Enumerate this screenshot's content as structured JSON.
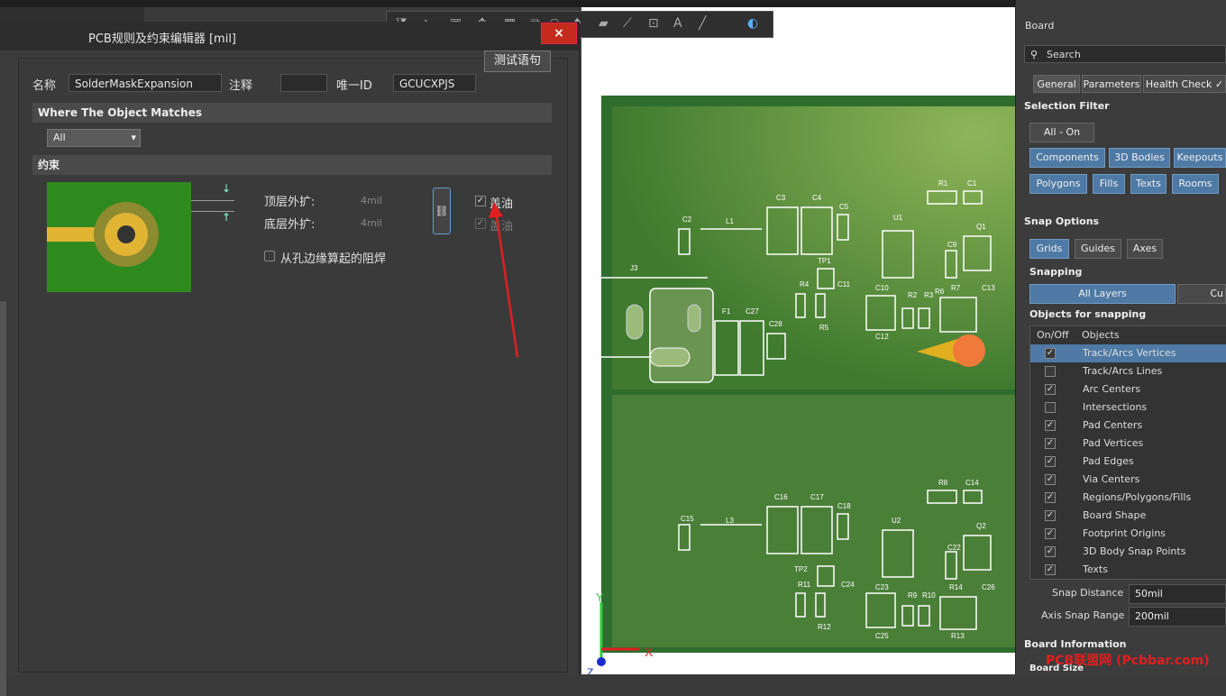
{
  "dialog": {
    "title": "PCB规则及约束编辑器 [mil]",
    "close": "×",
    "name_label": "名称",
    "name_value": "SolderMaskExpansion",
    "comment_label": "注释",
    "comment_value": "",
    "id_label": "唯一ID",
    "id_value": "GCUCXPJS",
    "test_button": "测试语句",
    "where_section": "Where The Object Matches",
    "where_value": "All",
    "constraint_section": "约束",
    "top_expand_label": "顶层外扩:",
    "top_expand_value": "4mil",
    "bottom_expand_label": "底层外扩:",
    "bottom_expand_value": "4mil",
    "cover_oil_1": "盖油",
    "cover_oil_2": "盖油",
    "from_hole_label": "从孔边缘算起的阻焊"
  },
  "pcb": {
    "labels": [
      "C2",
      "L1",
      "C3",
      "C4",
      "C5",
      "U1",
      "R1",
      "C1",
      "Q1",
      "C9",
      "J3",
      "TP1",
      "R4",
      "C11",
      "C10",
      "R2",
      "R3",
      "R6",
      "R7",
      "C13",
      "F1",
      "C27",
      "C28",
      "R5",
      "C12",
      "R8",
      "C14",
      "C15",
      "L3",
      "C16",
      "C17",
      "C18",
      "U2",
      "Q2",
      "C22",
      "TP2",
      "R11",
      "C24",
      "C23",
      "R9",
      "R10",
      "R14",
      "C26",
      "R12",
      "C25",
      "R13"
    ],
    "axis_y": "Y",
    "axis_x": "X",
    "axis_z": "Z"
  },
  "panel": {
    "title": "Board",
    "search_placeholder": "Search",
    "tabs": [
      "General",
      "Parameters",
      "Health Check ✓"
    ],
    "selection_filter": "Selection Filter",
    "all_on": "All - On",
    "filter_row1": [
      "Components",
      "3D Bodies",
      "Keepouts"
    ],
    "filter_row2": [
      "Polygons",
      "Fills",
      "Texts",
      "Rooms"
    ],
    "snap_options": "Snap Options",
    "snap_buttons": [
      "Grids",
      "Guides",
      "Axes"
    ],
    "snapping_label": "Snapping",
    "all_layers": "All Layers",
    "current_layer": "Cu",
    "objects_for_snapping": "Objects for snapping",
    "col_onoff": "On/Off",
    "col_objects": "Objects",
    "snap_objects": [
      {
        "name": "Track/Arcs Vertices",
        "checked": true
      },
      {
        "name": "Track/Arcs Lines",
        "checked": false
      },
      {
        "name": "Arc Centers",
        "checked": true
      },
      {
        "name": "Intersections",
        "checked": false
      },
      {
        "name": "Pad Centers",
        "checked": true
      },
      {
        "name": "Pad Vertices",
        "checked": true
      },
      {
        "name": "Pad Edges",
        "checked": true
      },
      {
        "name": "Via Centers",
        "checked": true
      },
      {
        "name": "Regions/Polygons/Fills",
        "checked": true
      },
      {
        "name": "Board Shape",
        "checked": true
      },
      {
        "name": "Footprint Origins",
        "checked": true
      },
      {
        "name": "3D Body Snap Points",
        "checked": true
      },
      {
        "name": "Texts",
        "checked": true
      }
    ],
    "snap_distance_label": "Snap Distance",
    "snap_distance_value": "50mil",
    "axis_snap_label": "Axis Snap Range",
    "axis_snap_value": "200mil",
    "board_information": "Board Information",
    "board_size": "Board Size"
  },
  "watermark": "PCB联盟网 (Pcbbar.com)"
}
